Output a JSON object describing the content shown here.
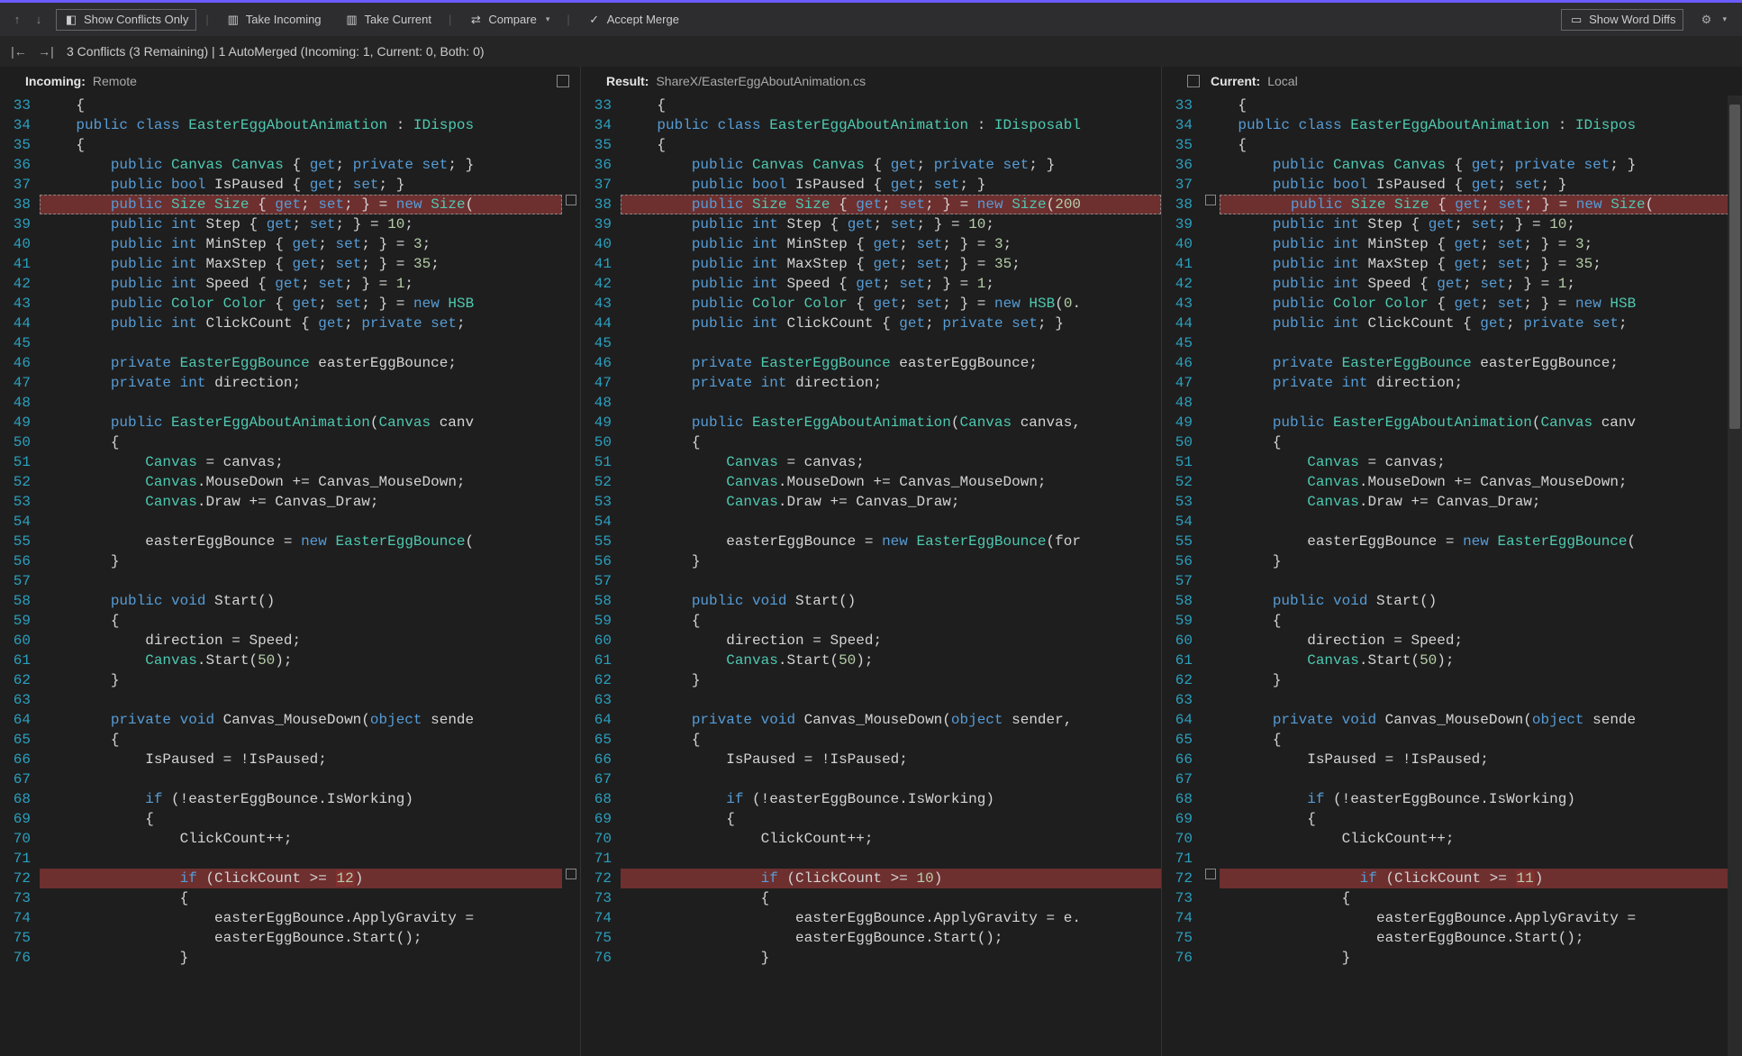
{
  "toolbar": {
    "show_conflicts_only": "Show Conflicts Only",
    "take_incoming": "Take Incoming",
    "take_current": "Take Current",
    "compare": "Compare",
    "accept_merge": "Accept Merge",
    "show_word_diffs": "Show Word Diffs"
  },
  "status": {
    "text": "3 Conflicts (3 Remaining) | 1 AutoMerged (Incoming: 1, Current: 0, Both: 0)"
  },
  "panes": {
    "incoming": {
      "label": "Incoming:",
      "sub": "Remote"
    },
    "result": {
      "label": "Result:",
      "sub": "ShareX/EasterEggAboutAnimation.cs"
    },
    "current": {
      "label": "Current:",
      "sub": "Local"
    }
  },
  "code": {
    "incoming": [
      {
        "n": 33,
        "t": "    {"
      },
      {
        "n": 34,
        "t": "    public class EasterEggAboutAnimation : IDispos"
      },
      {
        "n": 35,
        "t": "    {"
      },
      {
        "n": 36,
        "t": "        public Canvas Canvas { get; private set; }"
      },
      {
        "n": 37,
        "t": "        public bool IsPaused { get; set; }"
      },
      {
        "n": 38,
        "t": "        public Size Size { get; set; } = new Size(",
        "conflict": true,
        "dashed": true,
        "chk": "after"
      },
      {
        "n": 39,
        "t": "        public int Step { get; set; } = 10;"
      },
      {
        "n": 40,
        "t": "        public int MinStep { get; set; } = 3;"
      },
      {
        "n": 41,
        "t": "        public int MaxStep { get; set; } = 35;"
      },
      {
        "n": 42,
        "t": "        public int Speed { get; set; } = 1;"
      },
      {
        "n": 43,
        "t": "        public Color Color { get; set; } = new HSB"
      },
      {
        "n": 44,
        "t": "        public int ClickCount { get; private set; "
      },
      {
        "n": 45,
        "t": ""
      },
      {
        "n": 46,
        "t": "        private EasterEggBounce easterEggBounce;"
      },
      {
        "n": 47,
        "t": "        private int direction;"
      },
      {
        "n": 48,
        "t": ""
      },
      {
        "n": 49,
        "t": "        public EasterEggAboutAnimation(Canvas canv"
      },
      {
        "n": 50,
        "t": "        {"
      },
      {
        "n": 51,
        "t": "            Canvas = canvas;"
      },
      {
        "n": 52,
        "t": "            Canvas.MouseDown += Canvas_MouseDown;"
      },
      {
        "n": 53,
        "t": "            Canvas.Draw += Canvas_Draw;"
      },
      {
        "n": 54,
        "t": ""
      },
      {
        "n": 55,
        "t": "            easterEggBounce = new EasterEggBounce("
      },
      {
        "n": 56,
        "t": "        }"
      },
      {
        "n": 57,
        "t": ""
      },
      {
        "n": 58,
        "t": "        public void Start()"
      },
      {
        "n": 59,
        "t": "        {"
      },
      {
        "n": 60,
        "t": "            direction = Speed;"
      },
      {
        "n": 61,
        "t": "            Canvas.Start(50);"
      },
      {
        "n": 62,
        "t": "        }"
      },
      {
        "n": 63,
        "t": ""
      },
      {
        "n": 64,
        "t": "        private void Canvas_MouseDown(object sende"
      },
      {
        "n": 65,
        "t": "        {"
      },
      {
        "n": 66,
        "t": "            IsPaused = !IsPaused;"
      },
      {
        "n": 67,
        "t": ""
      },
      {
        "n": 68,
        "t": "            if (!easterEggBounce.IsWorking)"
      },
      {
        "n": 69,
        "t": "            {"
      },
      {
        "n": 70,
        "t": "                ClickCount++;"
      },
      {
        "n": 71,
        "t": ""
      },
      {
        "n": 72,
        "t": "                if (ClickCount >= 12)",
        "conflict": true,
        "word": "12",
        "chk": "after"
      },
      {
        "n": 73,
        "t": "                {"
      },
      {
        "n": 74,
        "t": "                    easterEggBounce.ApplyGravity ="
      },
      {
        "n": 75,
        "t": "                    easterEggBounce.Start();"
      },
      {
        "n": 76,
        "t": "                }"
      }
    ],
    "result": [
      {
        "n": 33,
        "t": "    {"
      },
      {
        "n": 34,
        "t": "    public class EasterEggAboutAnimation : IDisposabl"
      },
      {
        "n": 35,
        "t": "    {"
      },
      {
        "n": 36,
        "t": "        public Canvas Canvas { get; private set; }"
      },
      {
        "n": 37,
        "t": "        public bool IsPaused { get; set; }"
      },
      {
        "n": 38,
        "t": "        public Size Size { get; set; } = new Size(200",
        "conflict": true,
        "dashed": true
      },
      {
        "n": 39,
        "t": "        public int Step { get; set; } = 10;"
      },
      {
        "n": 40,
        "t": "        public int MinStep { get; set; } = 3;"
      },
      {
        "n": 41,
        "t": "        public int MaxStep { get; set; } = 35;"
      },
      {
        "n": 42,
        "t": "        public int Speed { get; set; } = 1;"
      },
      {
        "n": 43,
        "t": "        public Color Color { get; set; } = new HSB(0."
      },
      {
        "n": 44,
        "t": "        public int ClickCount { get; private set; }"
      },
      {
        "n": 45,
        "t": ""
      },
      {
        "n": 46,
        "t": "        private EasterEggBounce easterEggBounce;"
      },
      {
        "n": 47,
        "t": "        private int direction;"
      },
      {
        "n": 48,
        "t": ""
      },
      {
        "n": 49,
        "t": "        public EasterEggAboutAnimation(Canvas canvas,"
      },
      {
        "n": 50,
        "t": "        {"
      },
      {
        "n": 51,
        "t": "            Canvas = canvas;"
      },
      {
        "n": 52,
        "t": "            Canvas.MouseDown += Canvas_MouseDown;"
      },
      {
        "n": 53,
        "t": "            Canvas.Draw += Canvas_Draw;"
      },
      {
        "n": 54,
        "t": ""
      },
      {
        "n": 55,
        "t": "            easterEggBounce = new EasterEggBounce(for"
      },
      {
        "n": 56,
        "t": "        }"
      },
      {
        "n": 57,
        "t": ""
      },
      {
        "n": 58,
        "t": "        public void Start()"
      },
      {
        "n": 59,
        "t": "        {"
      },
      {
        "n": 60,
        "t": "            direction = Speed;"
      },
      {
        "n": 61,
        "t": "            Canvas.Start(50);"
      },
      {
        "n": 62,
        "t": "        }"
      },
      {
        "n": 63,
        "t": ""
      },
      {
        "n": 64,
        "t": "        private void Canvas_MouseDown(object sender,"
      },
      {
        "n": 65,
        "t": "        {"
      },
      {
        "n": 66,
        "t": "            IsPaused = !IsPaused;"
      },
      {
        "n": 67,
        "t": ""
      },
      {
        "n": 68,
        "t": "            if (!easterEggBounce.IsWorking)"
      },
      {
        "n": 69,
        "t": "            {"
      },
      {
        "n": 70,
        "t": "                ClickCount++;"
      },
      {
        "n": 71,
        "t": ""
      },
      {
        "n": 72,
        "t": "                if (ClickCount >= 10)",
        "conflict": true
      },
      {
        "n": 73,
        "t": "                {"
      },
      {
        "n": 74,
        "t": "                    easterEggBounce.ApplyGravity = e."
      },
      {
        "n": 75,
        "t": "                    easterEggBounce.Start();"
      },
      {
        "n": 76,
        "t": "                }"
      }
    ],
    "current": [
      {
        "n": 33,
        "t": "    {"
      },
      {
        "n": 34,
        "t": "    public class EasterEggAboutAnimation : IDispos"
      },
      {
        "n": 35,
        "t": "    {"
      },
      {
        "n": 36,
        "t": "        public Canvas Canvas { get; private set; }"
      },
      {
        "n": 37,
        "t": "        public bool IsPaused { get; set; }"
      },
      {
        "n": 38,
        "t": "        public Size Size { get; set; } = new Size(",
        "conflict": true,
        "dashed": true,
        "chk": "before"
      },
      {
        "n": 39,
        "t": "        public int Step { get; set; } = 10;"
      },
      {
        "n": 40,
        "t": "        public int MinStep { get; set; } = 3;"
      },
      {
        "n": 41,
        "t": "        public int MaxStep { get; set; } = 35;"
      },
      {
        "n": 42,
        "t": "        public int Speed { get; set; } = 1;"
      },
      {
        "n": 43,
        "t": "        public Color Color { get; set; } = new HSB"
      },
      {
        "n": 44,
        "t": "        public int ClickCount { get; private set; "
      },
      {
        "n": 45,
        "t": ""
      },
      {
        "n": 46,
        "t": "        private EasterEggBounce easterEggBounce;"
      },
      {
        "n": 47,
        "t": "        private int direction;"
      },
      {
        "n": 48,
        "t": ""
      },
      {
        "n": 49,
        "t": "        public EasterEggAboutAnimation(Canvas canv"
      },
      {
        "n": 50,
        "t": "        {"
      },
      {
        "n": 51,
        "t": "            Canvas = canvas;"
      },
      {
        "n": 52,
        "t": "            Canvas.MouseDown += Canvas_MouseDown;"
      },
      {
        "n": 53,
        "t": "            Canvas.Draw += Canvas_Draw;"
      },
      {
        "n": 54,
        "t": ""
      },
      {
        "n": 55,
        "t": "            easterEggBounce = new EasterEggBounce("
      },
      {
        "n": 56,
        "t": "        }"
      },
      {
        "n": 57,
        "t": ""
      },
      {
        "n": 58,
        "t": "        public void Start()"
      },
      {
        "n": 59,
        "t": "        {"
      },
      {
        "n": 60,
        "t": "            direction = Speed;"
      },
      {
        "n": 61,
        "t": "            Canvas.Start(50);"
      },
      {
        "n": 62,
        "t": "        }"
      },
      {
        "n": 63,
        "t": ""
      },
      {
        "n": 64,
        "t": "        private void Canvas_MouseDown(object sende"
      },
      {
        "n": 65,
        "t": "        {"
      },
      {
        "n": 66,
        "t": "            IsPaused = !IsPaused;"
      },
      {
        "n": 67,
        "t": ""
      },
      {
        "n": 68,
        "t": "            if (!easterEggBounce.IsWorking)"
      },
      {
        "n": 69,
        "t": "            {"
      },
      {
        "n": 70,
        "t": "                ClickCount++;"
      },
      {
        "n": 71,
        "t": ""
      },
      {
        "n": 72,
        "t": "                if (ClickCount >= 11)",
        "conflict": true,
        "word": "11",
        "chk": "before"
      },
      {
        "n": 73,
        "t": "                {"
      },
      {
        "n": 74,
        "t": "                    easterEggBounce.ApplyGravity ="
      },
      {
        "n": 75,
        "t": "                    easterEggBounce.Start();"
      },
      {
        "n": 76,
        "t": "                }"
      }
    ]
  }
}
